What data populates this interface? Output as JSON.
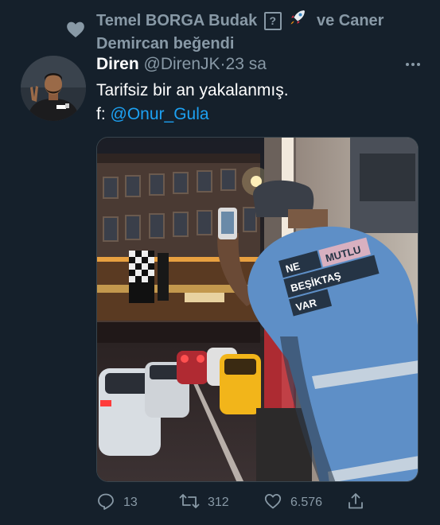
{
  "social_context": {
    "names": "Temel BORGA Budak",
    "box_glyph": "?",
    "suffix": "ve Caner Demircan beğendi",
    "icon": "heart-icon",
    "emoji_icon": "rocket-icon"
  },
  "tweet": {
    "display_name": "Diren",
    "handle": "@DirenJK",
    "separator": "·",
    "time": "23 sa",
    "text_line1": "Tarifsiz bir an yakalanmış.",
    "text_prefix": "f: ",
    "mention": "@Onur_Gula",
    "media": {
      "vest_lines": [
        "NE",
        "MUTLU",
        "BEŞİKTAŞ",
        "VAR"
      ]
    }
  },
  "actions": {
    "reply_count": "13",
    "retweet_count": "312",
    "like_count": "6.576",
    "icons": [
      "reply-icon",
      "retweet-icon",
      "like-icon",
      "share-icon"
    ]
  },
  "colors": {
    "background": "#15202b",
    "muted": "#8899a6",
    "link": "#1da1f2",
    "vest": "#5e8fc7"
  }
}
